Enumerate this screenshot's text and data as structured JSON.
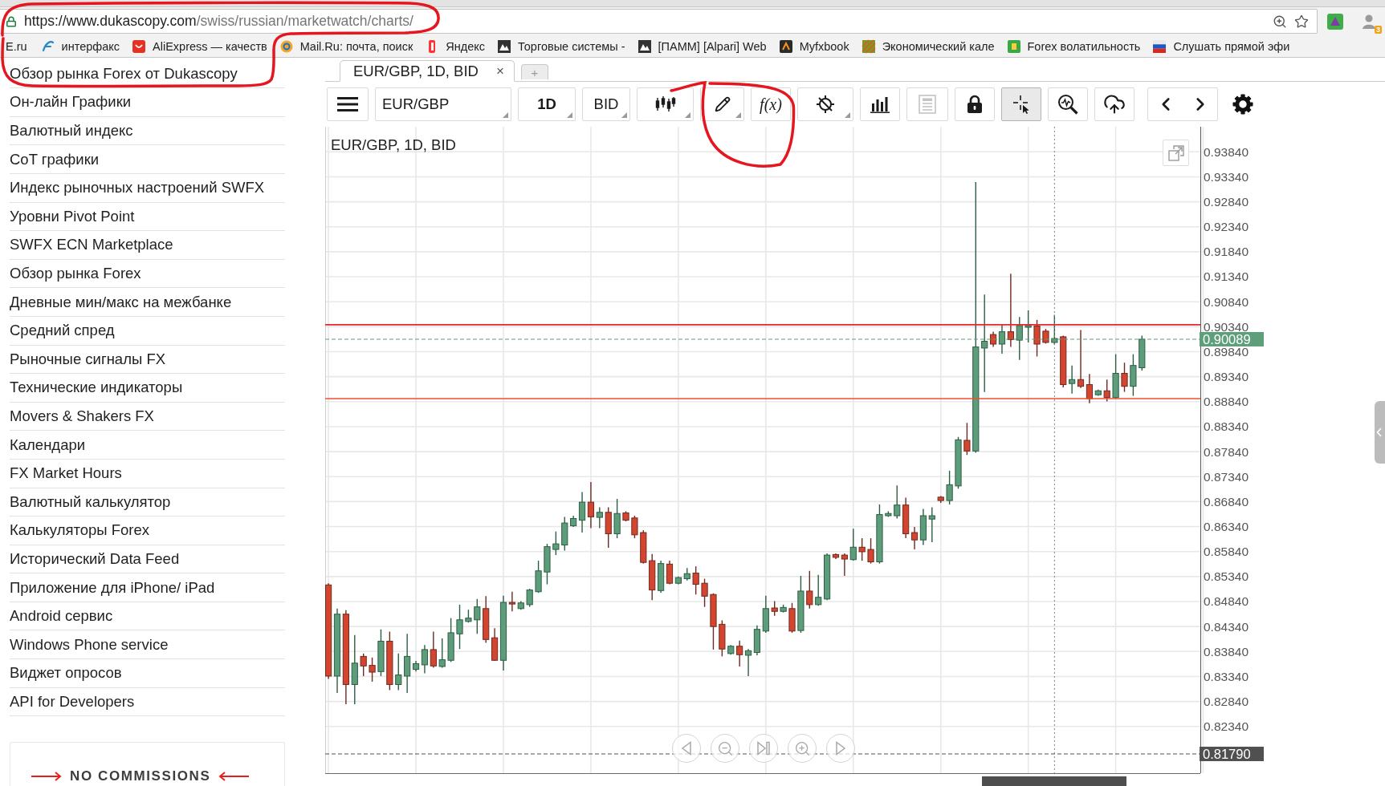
{
  "browser": {
    "url": "https://www.dukascopy.com/swiss/russian/marketwatch/charts/",
    "extension_badge": "3"
  },
  "bookmarks_cut": "E.ru",
  "bookmarks": [
    "интерфакс",
    "AliExpress — качеств",
    "Mail.Ru: почта, поиск",
    "Яндекс",
    "Торговые системы -",
    "[ПАММ] [Alpari] Web",
    "Myfxbook",
    "Экономический кале",
    "Forex волатильность",
    "Слушать прямой эфи"
  ],
  "sidebar": {
    "items": [
      "Обзор рынка Forex от Dukascopy",
      "Он-лайн Графики",
      "Валютный индекс",
      "CoT графики",
      "Индекс рыночных настроений SWFX",
      "Уровни Pivot Point",
      "SWFX ECN Marketplace",
      "Обзор рынка Forex",
      "Дневные мин/макс на межбанке",
      "Средний спред",
      "Рыночные сигналы FX",
      "Технические индикаторы",
      "Movers & Shakers FX",
      "Календари",
      "FX Market Hours",
      "Валютный калькулятор",
      "Калькуляторы Forex",
      "Исторический Data Feed",
      "Приложение для iPhone/ iPad",
      "Android сервис",
      "Windows Phone service",
      "Виджет опросов",
      "API for Developers"
    ],
    "banner": "NO COMMISSIONS"
  },
  "chart_tabs": [
    {
      "label": "EUR/GBP, 1D, BID",
      "close": "×",
      "selected": true
    }
  ],
  "new_tab": "+",
  "toolbar": [
    {
      "kind": "menu"
    },
    {
      "kind": "instrument",
      "label": "EUR/GBP",
      "dropdown": true
    },
    {
      "kind": "period",
      "label": "1D",
      "dropdown": true
    },
    {
      "kind": "side",
      "label": "BID",
      "dropdown": true
    },
    {
      "kind": "tool",
      "selected": false,
      "disabled": false,
      "dropdown": true
    },
    {
      "kind": "tool",
      "selected": false,
      "disabled": false,
      "dropdown": true
    },
    {
      "kind": "formula",
      "label": "f(x)",
      "selected": false,
      "disabled": false,
      "dropdown": false
    },
    {
      "kind": "tool",
      "selected": false,
      "disabled": false,
      "dropdown": true
    },
    {
      "kind": "tool",
      "selected": false,
      "disabled": false,
      "dropdown": false
    },
    {
      "kind": "tool",
      "selected": false,
      "disabled": true,
      "dropdown": false
    },
    {
      "kind": "tool",
      "selected": false,
      "disabled": false,
      "dropdown": false
    },
    {
      "kind": "tool",
      "selected": true,
      "disabled": false,
      "dropdown": false
    },
    {
      "kind": "tool",
      "selected": false,
      "disabled": false,
      "dropdown": false
    },
    {
      "kind": "tool",
      "selected": false,
      "disabled": false,
      "dropdown": false
    },
    {
      "kind": "pager"
    },
    {
      "kind": "settings"
    }
  ],
  "chart": {
    "chart_data": [
      {
        "type": "candlestick",
        "title": "EUR/GBP, 1D, BID",
        "tick_labels": "y",
        "grid": true,
        "ylim": [
          0.81405,
          0.94342
        ],
        "yticks": [
          {
            "value": 0.9384,
            "label": "0.93840"
          },
          {
            "value": 0.9334,
            "label": "0.93340"
          },
          {
            "value": 0.9284,
            "label": "0.92840"
          },
          {
            "value": 0.9234,
            "label": "0.92340"
          },
          {
            "value": 0.9184,
            "label": "0.91840"
          },
          {
            "value": 0.9134,
            "label": "0.91340"
          },
          {
            "value": 0.9084,
            "label": "0.90840"
          },
          {
            "value": 0.9034,
            "label": "0.90340"
          },
          {
            "value": 0.8984,
            "label": "0.89840"
          },
          {
            "value": 0.8934,
            "label": "0.89340"
          },
          {
            "value": 0.8884,
            "label": "0.88840"
          },
          {
            "value": 0.8834,
            "label": "0.88340"
          },
          {
            "value": 0.8784,
            "label": "0.87840"
          },
          {
            "value": 0.8734,
            "label": "0.87340"
          },
          {
            "value": 0.8684,
            "label": "0.86840"
          },
          {
            "value": 0.8634,
            "label": "0.86340"
          },
          {
            "value": 0.8584,
            "label": "0.85840"
          },
          {
            "value": 0.8534,
            "label": "0.85340"
          },
          {
            "value": 0.8484,
            "label": "0.84840"
          },
          {
            "value": 0.8434,
            "label": "0.84340"
          },
          {
            "value": 0.8384,
            "label": "0.83840"
          },
          {
            "value": 0.8334,
            "label": "0.83340"
          },
          {
            "value": 0.8284,
            "label": "0.82840"
          },
          {
            "value": 0.8234,
            "label": "0.82340"
          }
        ],
        "ohlc": [
          [
            0.85172,
            0.85206,
            0.83292,
            0.83348
          ],
          [
            0.83348,
            0.84699,
            0.83011,
            0.84587
          ],
          [
            0.84587,
            0.84666,
            0.82785,
            0.83179
          ],
          [
            0.83179,
            0.8417,
            0.82785,
            0.83607
          ],
          [
            0.83742,
            0.83799,
            0.83348,
            0.83551
          ],
          [
            0.83562,
            0.8372,
            0.83236,
            0.83427
          ],
          [
            0.83438,
            0.84283,
            0.83348,
            0.84046
          ],
          [
            0.84046,
            0.84238,
            0.83067,
            0.83179
          ],
          [
            0.83179,
            0.83799,
            0.83067,
            0.83371
          ],
          [
            0.83348,
            0.84193,
            0.83011,
            0.83742
          ],
          [
            0.83483,
            0.83652,
            0.83438,
            0.83596
          ],
          [
            0.83573,
            0.83968,
            0.83405,
            0.83878
          ],
          [
            0.83878,
            0.84238,
            0.83517,
            0.83551
          ],
          [
            0.8354,
            0.84103,
            0.83517,
            0.83675
          ],
          [
            0.83664,
            0.84508,
            0.8363,
            0.84215
          ],
          [
            0.84193,
            0.84778,
            0.83889,
            0.84474
          ],
          [
            0.84441,
            0.84677,
            0.84418,
            0.84508
          ],
          [
            0.84474,
            0.84891,
            0.84193,
            0.84733
          ],
          [
            0.84699,
            0.84947,
            0.84013,
            0.8408
          ],
          [
            0.84114,
            0.84305,
            0.83652,
            0.83664
          ],
          [
            0.83664,
            0.84958,
            0.83461,
            0.84823
          ],
          [
            0.84823,
            0.85037,
            0.84643,
            0.8479
          ],
          [
            0.84699,
            0.84846,
            0.84677,
            0.84812
          ],
          [
            0.84778,
            0.85094,
            0.84733,
            0.85071
          ],
          [
            0.85037,
            0.85657,
            0.85015,
            0.85454
          ],
          [
            0.85431,
            0.85994,
            0.85184,
            0.85938
          ],
          [
            0.85882,
            0.86242,
            0.85769,
            0.85994
          ],
          [
            0.85972,
            0.86535,
            0.85859,
            0.86411
          ],
          [
            0.86355,
            0.86557,
            0.86332,
            0.86501
          ],
          [
            0.86467,
            0.8703,
            0.8622,
            0.86828
          ],
          [
            0.86828,
            0.87233,
            0.8631,
            0.86535
          ],
          [
            0.86524,
            0.86726,
            0.8631,
            0.86625
          ],
          [
            0.86625,
            0.86726,
            0.85916,
            0.86197
          ],
          [
            0.86197,
            0.86895,
            0.86107,
            0.86602
          ],
          [
            0.86614,
            0.86647,
            0.86445,
            0.86467
          ],
          [
            0.86512,
            0.86557,
            0.86107,
            0.86175
          ],
          [
            0.8622,
            0.86265,
            0.856,
            0.85623
          ],
          [
            0.85657,
            0.85792,
            0.84868,
            0.85071
          ],
          [
            0.8506,
            0.85657,
            0.85015,
            0.856
          ],
          [
            0.85589,
            0.85657,
            0.85184,
            0.85206
          ],
          [
            0.85206,
            0.85341,
            0.85184,
            0.85319
          ],
          [
            0.85296,
            0.8551,
            0.85262,
            0.85398
          ],
          [
            0.85409,
            0.85544,
            0.84981,
            0.85184
          ],
          [
            0.85206,
            0.85296,
            0.84733,
            0.84947
          ],
          [
            0.84981,
            0.85004,
            0.83878,
            0.84339
          ],
          [
            0.84384,
            0.84463,
            0.83742,
            0.83889
          ],
          [
            0.83799,
            0.83968,
            0.83776,
            0.83945
          ],
          [
            0.83945,
            0.84057,
            0.8354,
            0.83776
          ],
          [
            0.83765,
            0.83889,
            0.83348,
            0.83855
          ],
          [
            0.83821,
            0.84362,
            0.83765,
            0.84283
          ],
          [
            0.84249,
            0.84958,
            0.84215,
            0.84699
          ],
          [
            0.84711,
            0.84846,
            0.84553,
            0.84643
          ],
          [
            0.84643,
            0.84778,
            0.84621,
            0.84722
          ],
          [
            0.84699,
            0.84812,
            0.84215,
            0.84249
          ],
          [
            0.8426,
            0.85353,
            0.84215,
            0.85049
          ],
          [
            0.85049,
            0.85454,
            0.84699,
            0.84778
          ],
          [
            0.84778,
            0.85375,
            0.84756,
            0.84925
          ],
          [
            0.84891,
            0.85803,
            0.84868,
            0.85769
          ],
          [
            0.8578,
            0.85803,
            0.8569,
            0.85724
          ],
          [
            0.85769,
            0.85803,
            0.85353,
            0.8569
          ],
          [
            0.85679,
            0.86298,
            0.85657,
            0.85927
          ],
          [
            0.85927,
            0.86107,
            0.85657,
            0.85837
          ],
          [
            0.85882,
            0.86107,
            0.856,
            0.85634
          ],
          [
            0.85634,
            0.86783,
            0.856,
            0.8658
          ],
          [
            0.86557,
            0.86647,
            0.86535,
            0.86602
          ],
          [
            0.86557,
            0.87165,
            0.86501,
            0.86771
          ],
          [
            0.86771,
            0.86918,
            0.86107,
            0.86197
          ],
          [
            0.8622,
            0.86332,
            0.85882,
            0.86073
          ],
          [
            0.86073,
            0.86693,
            0.85972,
            0.86557
          ],
          [
            0.8649,
            0.86726,
            0.86028,
            0.86557
          ],
          [
            0.86929,
            0.86951,
            0.86816,
            0.86861
          ],
          [
            0.86861,
            0.87458,
            0.86783,
            0.87177
          ],
          [
            0.87154,
            0.88134,
            0.87098,
            0.88077
          ],
          [
            0.88066,
            0.88415,
            0.87773,
            0.87852
          ],
          [
            0.87852,
            0.93235,
            0.87819,
            0.89935
          ],
          [
            0.89913,
            0.90983,
            0.89035,
            0.90048
          ],
          [
            0.90183,
            0.90239,
            0.89935,
            0.89992
          ],
          [
            0.89992,
            0.90386,
            0.898,
            0.90239
          ],
          [
            0.90239,
            0.91399,
            0.89935,
            0.90082
          ],
          [
            0.90071,
            0.90532,
            0.89676,
            0.90363
          ],
          [
            0.90329,
            0.90667,
            0.90025,
            0.90363
          ],
          [
            0.90352,
            0.90476,
            0.89744,
            0.89992
          ],
          [
            0.90251,
            0.90296,
            0.90003,
            0.90025
          ],
          [
            0.90025,
            0.90577,
            0.8998,
            0.90104
          ],
          [
            0.90138,
            0.90161,
            0.89125,
            0.89181
          ],
          [
            0.89203,
            0.89564,
            0.89001,
            0.89282
          ],
          [
            0.89282,
            0.90273,
            0.89113,
            0.89147
          ],
          [
            0.89181,
            0.89395,
            0.88809,
            0.88899
          ],
          [
            0.88978,
            0.8908,
            0.88956,
            0.89057
          ],
          [
            0.89057,
            0.89282,
            0.88843,
            0.88922
          ],
          [
            0.88922,
            0.89789,
            0.88899,
            0.89406
          ],
          [
            0.89406,
            0.8962,
            0.89035,
            0.89147
          ],
          [
            0.89147,
            0.89789,
            0.88956,
            0.89564
          ],
          [
            0.89519,
            0.90161,
            0.89462,
            0.90089
          ]
        ],
        "ref_lines": [
          {
            "axis": "y",
            "value": 0.9038,
            "color": "#e8242c",
            "line_style": "solid"
          },
          {
            "axis": "y",
            "value": 0.889,
            "color": "#f04e30",
            "line_style": "solid"
          },
          {
            "axis": "y",
            "value": 0.90089,
            "label": "0.90089",
            "color": "#5f9e7a",
            "line_style": "dashed"
          },
          {
            "axis": "y",
            "value": 0.8179,
            "label": "0.81790",
            "color": "#505050",
            "line_style": "dashed"
          }
        ]
      }
    ]
  }
}
